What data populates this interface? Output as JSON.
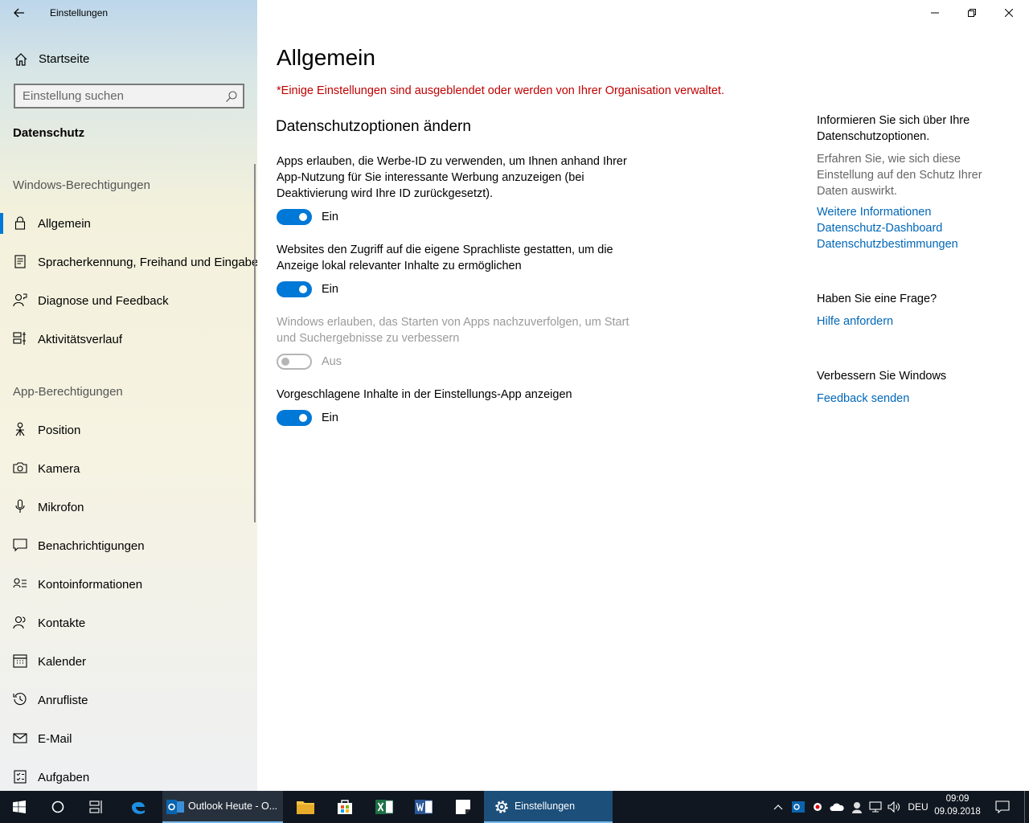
{
  "window": {
    "title": "Einstellungen",
    "back_icon": "back-arrow-icon"
  },
  "sidebar": {
    "home_label": "Startseite",
    "search_placeholder": "Einstellung suchen",
    "category_title": "Datenschutz",
    "group_windows": "Windows-Berechtigungen",
    "windows_items": [
      {
        "label": "Allgemein",
        "icon": "lock-icon",
        "active": true
      },
      {
        "label": "Spracherkennung, Freihand und Eingabe",
        "icon": "speech-document-icon"
      },
      {
        "label": "Diagnose und Feedback",
        "icon": "person-feedback-icon"
      },
      {
        "label": "Aktivitätsverlauf",
        "icon": "timeline-icon"
      }
    ],
    "group_apps": "App-Berechtigungen",
    "app_items": [
      {
        "label": "Position",
        "icon": "location-person-icon"
      },
      {
        "label": "Kamera",
        "icon": "camera-icon"
      },
      {
        "label": "Mikrofon",
        "icon": "microphone-icon"
      },
      {
        "label": "Benachrichtigungen",
        "icon": "notification-icon"
      },
      {
        "label": "Kontoinformationen",
        "icon": "account-info-icon"
      },
      {
        "label": "Kontakte",
        "icon": "contacts-icon"
      },
      {
        "label": "Kalender",
        "icon": "calendar-icon"
      },
      {
        "label": "Anrufliste",
        "icon": "call-history-icon"
      },
      {
        "label": "E-Mail",
        "icon": "mail-icon"
      },
      {
        "label": "Aufgaben",
        "icon": "tasks-icon"
      }
    ]
  },
  "main": {
    "title": "Allgemein",
    "org_notice": "*Einige Einstellungen sind ausgeblendet oder werden von Ihrer Organisation verwaltet.",
    "subheading": "Datenschutzoptionen ändern",
    "options": [
      {
        "text": "Apps erlauben, die Werbe-ID zu verwenden, um Ihnen anhand Ihrer App-Nutzung für Sie interessante Werbung anzuzeigen (bei Deaktivierung wird Ihre ID zurückgesetzt).",
        "state": "Ein",
        "on": true,
        "disabled": false
      },
      {
        "text": "Websites den Zugriff auf die eigene Sprachliste gestatten, um die Anzeige lokal relevanter Inhalte zu ermöglichen",
        "state": "Ein",
        "on": true,
        "disabled": false
      },
      {
        "text": "Windows erlauben, das Starten von Apps nachzuverfolgen, um Start und Suchergebnisse zu verbessern",
        "state": "Aus",
        "on": false,
        "disabled": true
      },
      {
        "text": "Vorgeschlagene Inhalte in der Einstellungs-App anzeigen",
        "state": "Ein",
        "on": true,
        "disabled": false
      }
    ]
  },
  "aside": {
    "info_heading": "Informieren Sie sich über Ihre Datenschutzoptionen.",
    "info_text": "Erfahren Sie, wie sich diese Einstellung auf den Schutz Ihrer Daten auswirkt.",
    "links": [
      "Weitere Informationen",
      "Datenschutz-Dashboard",
      "Datenschutzbestimmungen"
    ],
    "question_heading": "Haben Sie eine Frage?",
    "question_link": "Hilfe anfordern",
    "improve_heading": "Verbessern Sie Windows",
    "improve_link": "Feedback senden"
  },
  "taskbar": {
    "outlook_label": "Outlook Heute - O...",
    "settings_label": "Einstellungen",
    "language": "DEU",
    "time": "09:09",
    "date": "09.09.2018"
  },
  "colors": {
    "accent": "#0078d7",
    "link": "#0067b8",
    "warning": "#c00000",
    "taskbar": "#101720"
  }
}
